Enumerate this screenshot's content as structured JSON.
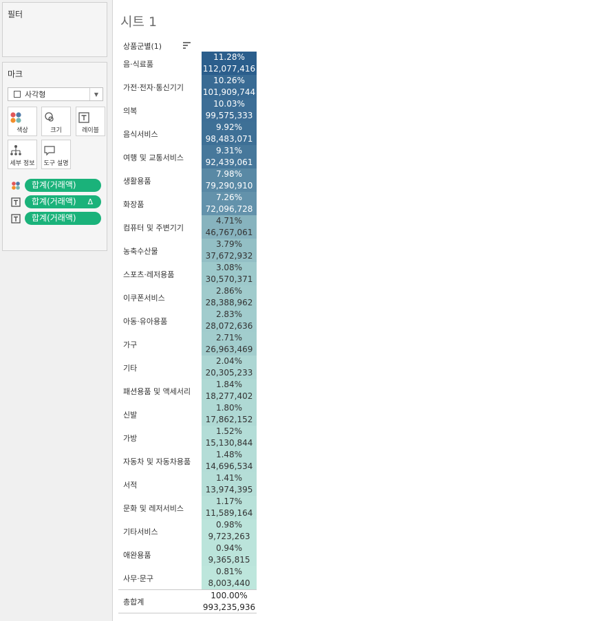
{
  "sidebar": {
    "filters_title": "필터",
    "marks_title": "마크",
    "mark_type": "사각형",
    "shelf": {
      "color": "색상",
      "size": "크기",
      "label": "레이블",
      "detail": "세부 정보",
      "tooltip": "도구 설명"
    },
    "pills": [
      {
        "label": "합계(거래액)",
        "icon": "color-dots-icon",
        "delta": ""
      },
      {
        "label": "합계(거래액)",
        "icon": "text-icon",
        "delta": "Δ"
      },
      {
        "label": "합계(거래액)",
        "icon": "text-icon",
        "delta": ""
      }
    ]
  },
  "sheet": {
    "title": "시트 1",
    "column_header": "상품군별(1)",
    "total_label": "총합계",
    "total_pct": "100.00%",
    "total_value": "993,235,936"
  },
  "chart_data": {
    "type": "table",
    "color_scale": [
      "#2b5e8c",
      "#bde6dc"
    ],
    "rows": [
      {
        "label": "음·식료품",
        "pct": "11.28%",
        "value": "112,077,416"
      },
      {
        "label": "가전·전자·통신기기",
        "pct": "10.26%",
        "value": "101,909,744"
      },
      {
        "label": "의복",
        "pct": "10.03%",
        "value": "99,575,333"
      },
      {
        "label": "음식서비스",
        "pct": "9.92%",
        "value": "98,483,071"
      },
      {
        "label": "여행 및 교통서비스",
        "pct": "9.31%",
        "value": "92,439,061"
      },
      {
        "label": "생활용품",
        "pct": "7.98%",
        "value": "79,290,910"
      },
      {
        "label": "화장품",
        "pct": "7.26%",
        "value": "72,096,728"
      },
      {
        "label": "컴퓨터 및 주변기기",
        "pct": "4.71%",
        "value": "46,767,061"
      },
      {
        "label": "농축수산물",
        "pct": "3.79%",
        "value": "37,672,932"
      },
      {
        "label": "스포츠·레저용품",
        "pct": "3.08%",
        "value": "30,570,371"
      },
      {
        "label": "이쿠폰서비스",
        "pct": "2.86%",
        "value": "28,388,962"
      },
      {
        "label": "아동·유아용품",
        "pct": "2.83%",
        "value": "28,072,636"
      },
      {
        "label": "가구",
        "pct": "2.71%",
        "value": "26,963,469"
      },
      {
        "label": "기타",
        "pct": "2.04%",
        "value": "20,305,233"
      },
      {
        "label": "패션용품 및 액세서리",
        "pct": "1.84%",
        "value": "18,277,402"
      },
      {
        "label": "신발",
        "pct": "1.80%",
        "value": "17,862,152"
      },
      {
        "label": "가방",
        "pct": "1.52%",
        "value": "15,130,844"
      },
      {
        "label": "자동차 및 자동차용품",
        "pct": "1.48%",
        "value": "14,696,534"
      },
      {
        "label": "서적",
        "pct": "1.41%",
        "value": "13,974,395"
      },
      {
        "label": "문화 및 레저서비스",
        "pct": "1.17%",
        "value": "11,589,164"
      },
      {
        "label": "기타서비스",
        "pct": "0.98%",
        "value": "9,723,263"
      },
      {
        "label": "애완용품",
        "pct": "0.94%",
        "value": "9,365,815"
      },
      {
        "label": "사무·문구",
        "pct": "0.81%",
        "value": "8,003,440"
      }
    ]
  }
}
